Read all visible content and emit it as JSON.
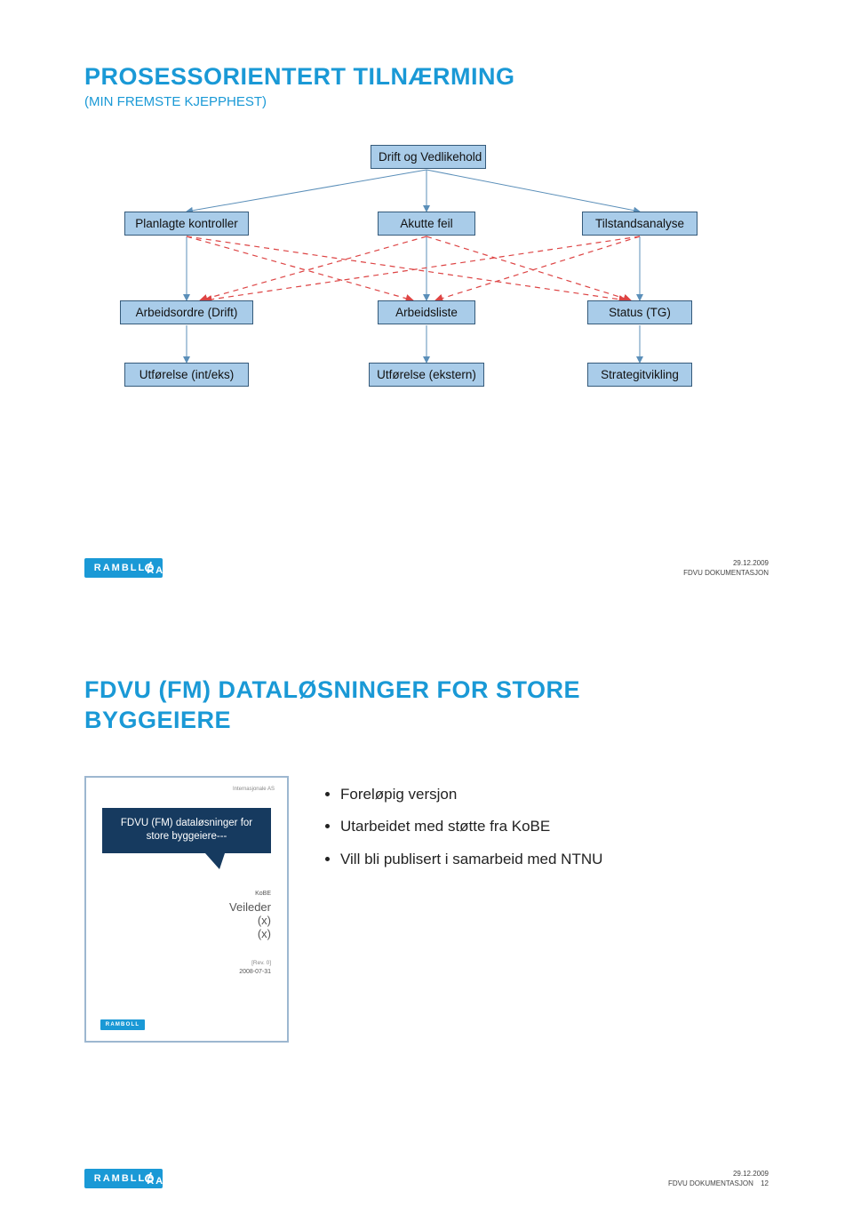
{
  "slide1": {
    "title": "PROSESSORIENTERT TILNÆRMING",
    "subtitle": "(MIN FREMSTE KJEPPHEST)",
    "nodes": {
      "top": "Drift og Vedlikehold",
      "row2": [
        "Planlagte kontroller",
        "Akutte feil",
        "Tilstandsanalyse"
      ],
      "row3": [
        "Arbeidsordre (Drift)",
        "Arbeidsliste",
        "Status (TG)"
      ],
      "row4": [
        "Utførelse (int/eks)",
        "Utførelse (ekstern)",
        "Strategitvikling"
      ]
    },
    "footer": {
      "date": "29.12.2009",
      "doc": "FDVU DOKUMENTASJON"
    }
  },
  "slide2": {
    "title": "FDVU (FM) DATALØSNINGER FOR STORE BYGGEIERE",
    "thumbnail": {
      "topright": "Internasjonale AS",
      "banner": "FDVU (FM) dataløsninger for store byggeiere---",
      "mid": "KoBE",
      "heading": "Veileder",
      "line2": "(x)",
      "line3": "(x)",
      "rev": "[Rev. 0]",
      "date": "2008-07-31",
      "tlogo": "RAMBOLL"
    },
    "bullets": [
      "Foreløpig versjon",
      "Utarbeidet med støtte fra KoBE",
      "Vill bli publisert i samarbeid med NTNU"
    ],
    "footer": {
      "date": "29.12.2009",
      "doc": "FDVU DOKUMENTASJON",
      "page": "12"
    }
  },
  "brand": "RAMBOLL"
}
